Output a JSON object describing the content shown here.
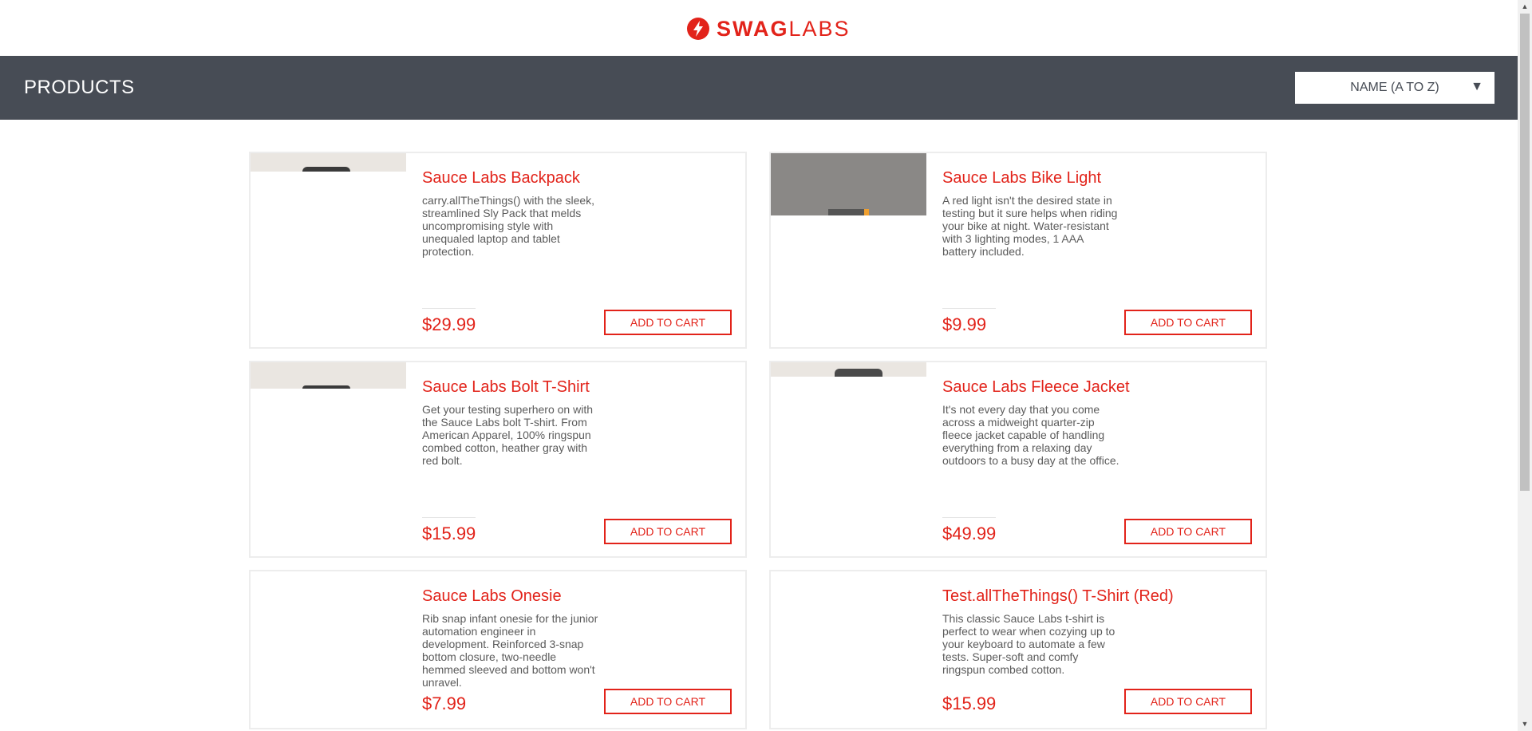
{
  "brand": {
    "logo_bold": "SWAG",
    "logo_light": "LABS",
    "accent_color": "#e2231a"
  },
  "header": {
    "title": "PRODUCTS",
    "background": "#474c55"
  },
  "sort": {
    "selected": "NAME (A TO Z)"
  },
  "products": [
    {
      "name": "Sauce Labs Backpack",
      "description": "carry.allTheThings() with the sleek, streamlined Sly Pack that melds uncompromising style with unequaled laptop and tablet protection.",
      "price": "$29.99",
      "button": "ADD TO CART"
    },
    {
      "name": "Sauce Labs Bike Light",
      "description": "A red light isn't the desired state in testing but it sure helps when riding your bike at night. Water-resistant with 3 lighting modes, 1 AAA battery included.",
      "price": "$9.99",
      "button": "ADD TO CART"
    },
    {
      "name": "Sauce Labs Bolt T-Shirt",
      "description": "Get your testing superhero on with the Sauce Labs bolt T-shirt. From American Apparel, 100% ringspun combed cotton, heather gray with red bolt.",
      "price": "$15.99",
      "button": "ADD TO CART"
    },
    {
      "name": "Sauce Labs Fleece Jacket",
      "description": "It's not every day that you come across a midweight quarter-zip fleece jacket capable of handling everything from a relaxing day outdoors to a busy day at the office.",
      "price": "$49.99",
      "button": "ADD TO CART"
    },
    {
      "name": "Sauce Labs Onesie",
      "description": "Rib snap infant onesie for the junior automation engineer in development. Reinforced 3-snap bottom closure, two-needle hemmed sleeved and bottom won't unravel.",
      "price": "$7.99",
      "button": "ADD TO CART"
    },
    {
      "name": "Test.allTheThings() T-Shirt (Red)",
      "description": "This classic Sauce Labs t-shirt is perfect to wear when cozying up to your keyboard to automate a few tests. Super-soft and comfy ringspun combed cotton.",
      "price": "$15.99",
      "button": "ADD TO CART"
    }
  ]
}
